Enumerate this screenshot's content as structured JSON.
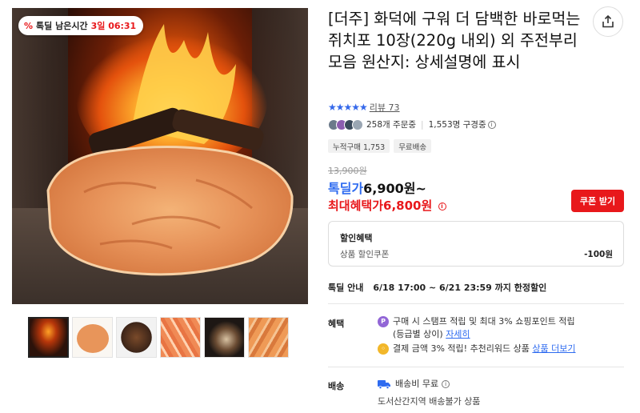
{
  "timer": {
    "label": "톡딜 남은시간",
    "time": "3일 06:31"
  },
  "product": {
    "title": "[더주] 화덕에 구워 더 담백한 바로먹는 쥐치포 10장(220g 내외) 외 주전부리 모음 원산지: 상세설명에 표시"
  },
  "rating": {
    "stars": 4.5,
    "review_label": "리뷰 73"
  },
  "social": {
    "orders": "258개 주문중",
    "subscribers": "1,553명 구경중"
  },
  "tags": [
    "누적구매 1,753",
    "무료배송"
  ],
  "price": {
    "original": "13,900원",
    "deal_label": "톡딜가",
    "deal_value": "6,900원~",
    "max_label": "최대혜택가",
    "max_value": "6,800원"
  },
  "coupon_button": "쿠폰 받기",
  "discount": {
    "title": "할인혜택",
    "item": "상품 할인쿠폰",
    "amount": "-100원"
  },
  "deal_notice": {
    "label": "톡딜 안내",
    "period": "6/18 17:00 ~ 6/21 23:59 까지 한정할인"
  },
  "benefit": {
    "label": "혜택",
    "stamp_text": "구매 시 스탬프 적립 및 최대 3% 쇼핑포인트 적립",
    "stamp_text2": "(등급별 상이)",
    "stamp_link": "자세히",
    "pay_text": "결제 금액 3% 적립! 추천리워드 상품",
    "pay_link": "상품 더보기"
  },
  "shipping": {
    "label": "배송",
    "fee": "배송비 무료",
    "note": "도서산간지역 배송불가 상품"
  },
  "colors": {
    "accent_blue": "#2e6bf0",
    "accent_red": "#e8181b",
    "star": "#3468ea"
  }
}
